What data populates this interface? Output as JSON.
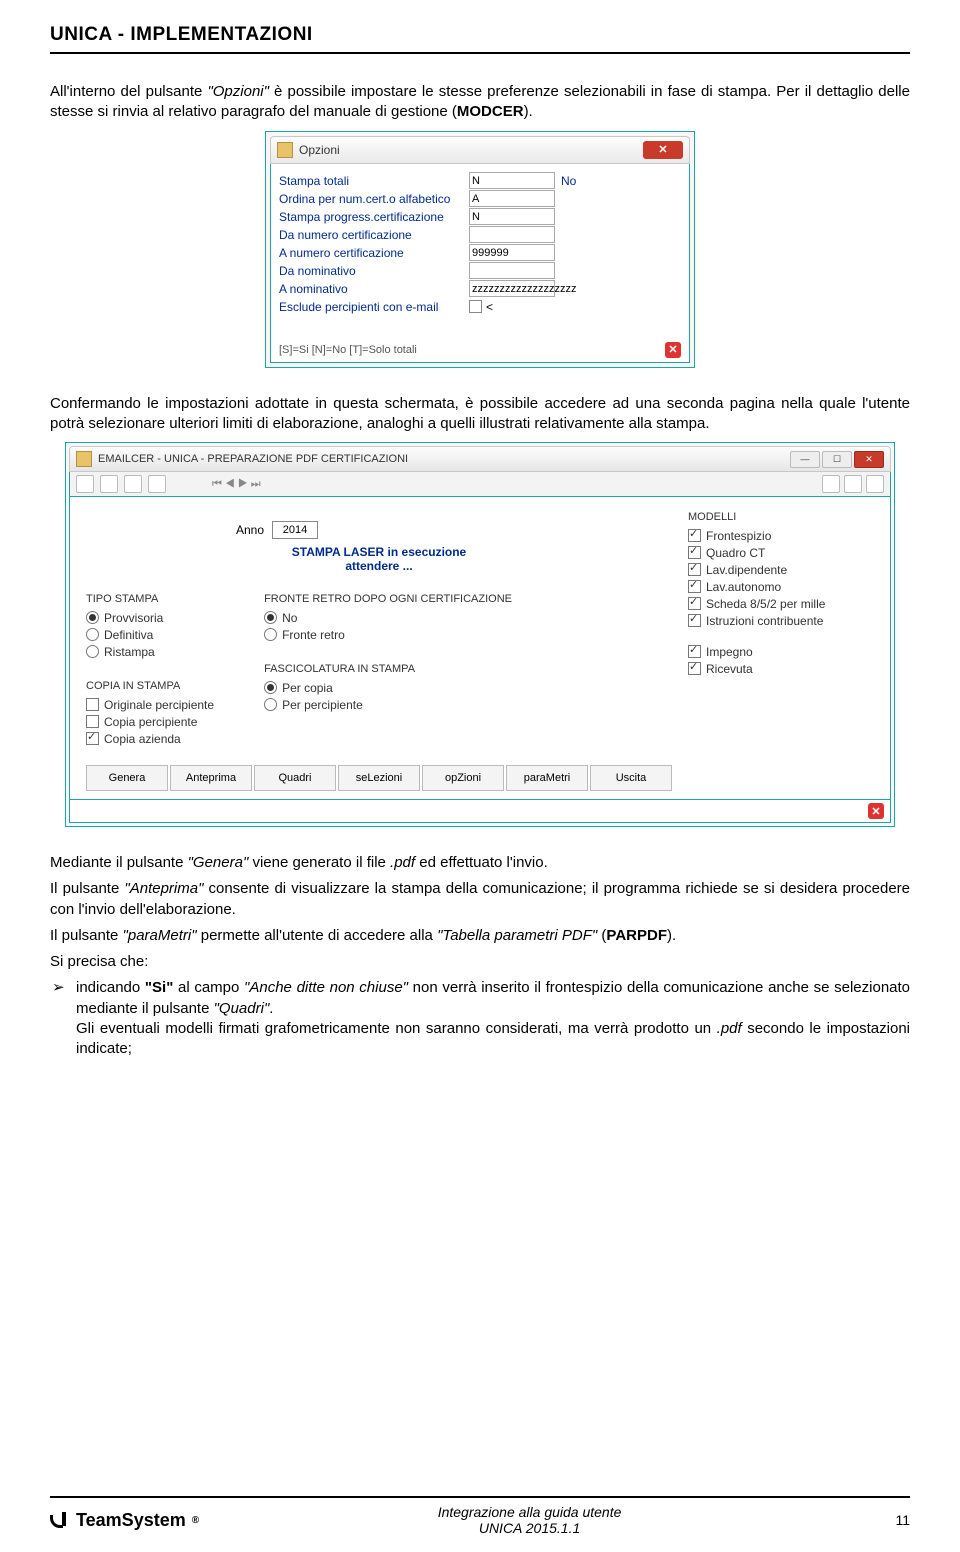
{
  "header": {
    "title": "UNICA - IMPLEMENTAZIONI"
  },
  "p1": {
    "a": "All'interno del pulsante ",
    "b": "\"Opzioni\"",
    "c": " è possibile impostare le stesse preferenze selezionabili in fase di stampa. Per il dettaglio delle stesse si rinvia al relativo paragrafo del manuale di gestione (",
    "d": "MODCER",
    "e": ")."
  },
  "opzioni": {
    "title": "Opzioni",
    "rows": [
      {
        "label": "Stampa totali",
        "value": "N",
        "after": "No"
      },
      {
        "label": "Ordina per num.cert.o alfabetico",
        "value": "A",
        "after": ""
      },
      {
        "label": "Stampa progress.certificazione",
        "value": "N",
        "after": ""
      },
      {
        "label": "Da numero certificazione",
        "value": "",
        "after": ""
      },
      {
        "label": "A numero certificazione",
        "value": "999999",
        "after": ""
      },
      {
        "label": "Da nominativo",
        "value": "",
        "after": ""
      },
      {
        "label": "A nominativo",
        "value": "zzzzzzzzzzzzzzzzzzz",
        "after": ""
      }
    ],
    "esclude": {
      "label": "Esclude percipienti con e-mail",
      "after": "<"
    },
    "hint": "[S]=Si [N]=No [T]=Solo totali"
  },
  "p2": "Confermando le impostazioni adottate in questa schermata, è possibile accedere ad una seconda pagina nella quale l'utente potrà selezionare ulteriori limiti di elaborazione, analoghi a quelli illustrati relativamente alla stampa.",
  "emailcer": {
    "title": "EMAILCER - UNICA - PREPARAZIONE PDF CERTIFICAZIONI",
    "anno_label": "Anno",
    "anno": "2014",
    "msg1": "STAMPA LASER in esecuzione",
    "msg2": "attendere ...",
    "modelli_label": "MODELLI",
    "modelli": [
      "Frontespizio",
      "Quadro CT",
      "Lav.dipendente",
      "Lav.autonomo",
      "Scheda 8/5/2 per mille",
      "Istruzioni contribuente"
    ],
    "modelli2": [
      "Impegno",
      "Ricevuta"
    ],
    "tipo_label": "TIPO STAMPA",
    "tipo": [
      "Provvisoria",
      "Definitiva",
      "Ristampa"
    ],
    "fronte_label": "FRONTE RETRO DOPO OGNI CERTIFICAZIONE",
    "fronte": [
      "No",
      "Fronte retro"
    ],
    "copia_label": "COPIA IN STAMPA",
    "copia": [
      "Originale percipiente",
      "Copia percipiente",
      "Copia azienda"
    ],
    "fasc_label": "FASCICOLATURA IN STAMPA",
    "fasc": [
      "Per copia",
      "Per percipiente"
    ],
    "buttons": [
      "Genera",
      "Anteprima",
      "Quadri",
      "seLezioni",
      "opZioni",
      "paraMetri",
      "Uscita"
    ]
  },
  "p3": {
    "a": "Mediante il pulsante ",
    "b": "\"Genera\"",
    "c": " viene generato il file ",
    "d": ".pdf",
    "e": " ed effettuato l'invio."
  },
  "p4": {
    "a": "Il pulsante ",
    "b": "\"Anteprima\"",
    "c": " consente di visualizzare la stampa della comunicazione; il programma richiede se si desidera procedere con l'invio dell'elaborazione."
  },
  "p5": {
    "a": "Il pulsante ",
    "b": "\"paraMetri\"",
    "c": " permette all'utente di accedere alla ",
    "d": "\"Tabella parametri PDF\"",
    "e": " (",
    "f": "PARPDF",
    "g": ")."
  },
  "p6": "Si precisa che:",
  "bullet1": {
    "a": "indicando ",
    "b": "\"Si\"",
    "c": " al campo ",
    "d": "\"Anche ditte non chiuse\"",
    "e": " non verrà inserito il frontespizio della comunicazione anche se selezionato mediante il pulsante ",
    "f": "\"Quadri\"",
    "g": "."
  },
  "bullet2": {
    "a": "Gli eventuali modelli firmati grafometricamente non saranno considerati, ma verrà prodotto un ",
    "b": ".pdf",
    "c": " secondo le impostazioni indicate;"
  },
  "footer": {
    "brand": "TeamSystem",
    "line1": "Integrazione alla guida utente",
    "line2": "UNICA 2015.1.1",
    "page": "11"
  }
}
